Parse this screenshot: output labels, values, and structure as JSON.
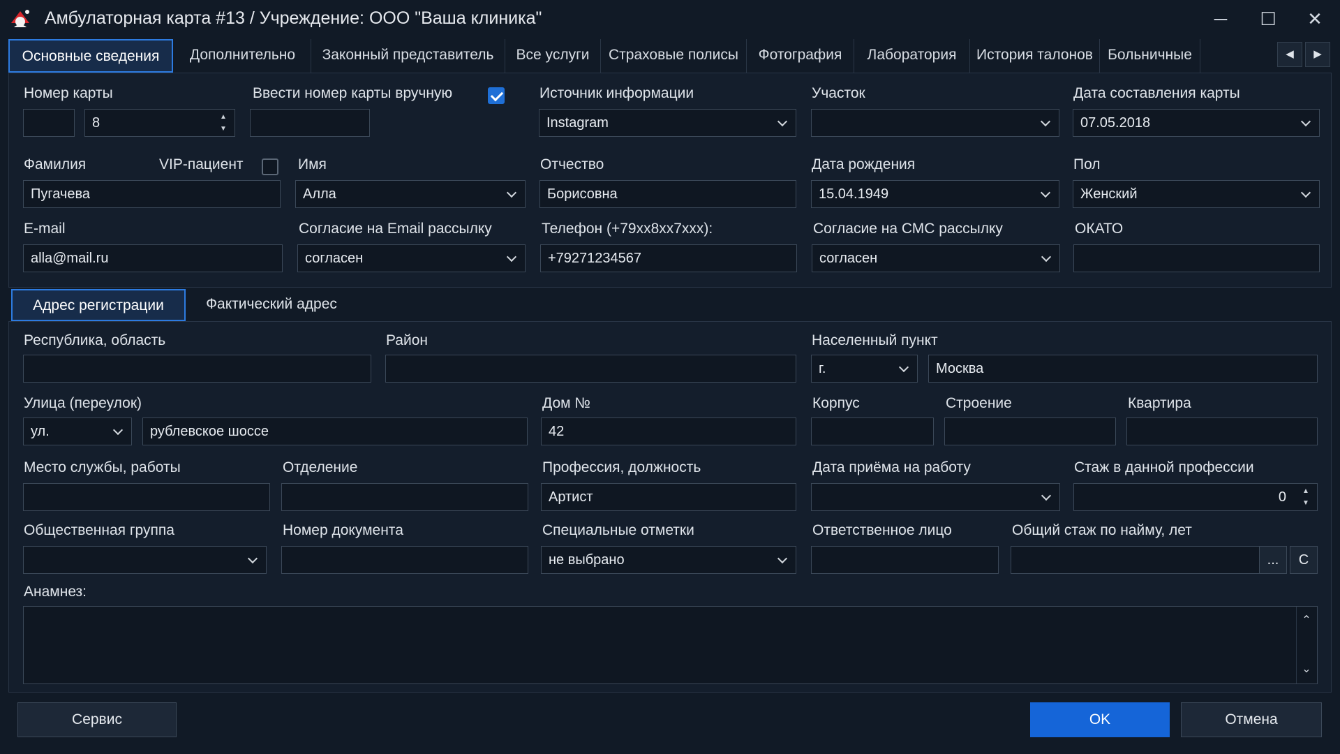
{
  "window": {
    "title": "Амбулаторная карта #13 / Учреждение: ООО \"Ваша клиника\"",
    "icon": "app-logo-icon",
    "minimize": "─",
    "maximize": "☐",
    "close": "✕"
  },
  "tabs": [
    {
      "label": "Основные сведения"
    },
    {
      "label": "Дополнительно"
    },
    {
      "label": "Законный представитель"
    },
    {
      "label": "Все услуги"
    },
    {
      "label": "Страховые полисы"
    },
    {
      "label": "Фотография"
    },
    {
      "label": "Лаборатория"
    },
    {
      "label": "История талонов"
    },
    {
      "label": "Больничные"
    }
  ],
  "tab_nav": {
    "prev": "◀",
    "next": "▶"
  },
  "main": {
    "card_number_label": "Номер карты",
    "card_number_prefix": "",
    "card_number_value": "8",
    "manual_label": "Ввести номер карты вручную",
    "manual_checked": true,
    "manual_value": "",
    "source_label": "Источник информации",
    "source_value": "Instagram",
    "district_label": "Участок",
    "district_value": "",
    "card_date_label": "Дата составления карты",
    "card_date_value": "07.05.2018",
    "surname_label": "Фамилия",
    "surname_value": "Пугачева",
    "vip_label": "VIP-пациент",
    "vip_checked": false,
    "name_label": "Имя",
    "name_value": "Алла",
    "patronymic_label": "Отчество",
    "patronymic_value": "Борисовна",
    "birth_label": "Дата рождения",
    "birth_value": "15.04.1949",
    "sex_label": "Пол",
    "sex_value": "Женский",
    "email_label": "E-mail",
    "email_value": "alla@mail.ru",
    "email_consent_label": "Согласие на Email рассылку",
    "email_consent_value": "согласен",
    "phone_label": "Телефон (+79xx8xx7xxx):",
    "phone_value": "+79271234567",
    "sms_consent_label": "Согласие на СМС рассылку",
    "sms_consent_value": "согласен",
    "okato_label": "ОКАТО",
    "okato_value": ""
  },
  "address_tabs": [
    {
      "label": "Адрес регистрации"
    },
    {
      "label": "Фактический адрес"
    }
  ],
  "address": {
    "region_label": "Республика, область",
    "region_value": "",
    "area_label": "Район",
    "area_value": "",
    "locality_label": "Населенный пункт",
    "locality_type": "г.",
    "locality_value": "Москва",
    "street_label": "Улица (переулок)",
    "street_type": "ул.",
    "street_value": "рублевское шоссе",
    "house_label": "Дом №",
    "house_value": "42",
    "building_label": "Корпус",
    "building_value": "",
    "structure_label": "Строение",
    "structure_value": "",
    "flat_label": "Квартира",
    "flat_value": "",
    "work_label": "Место службы, работы",
    "work_value": "",
    "dept_label": "Отделение",
    "dept_value": "",
    "profession_label": "Профессия, должность",
    "profession_value": "Артист",
    "hire_date_label": "Дата приёма на работу",
    "hire_date_value": "",
    "experience_label": "Стаж в данной профессии",
    "experience_value": "0",
    "group_label": "Общественная группа",
    "group_value": "",
    "doc_label": "Номер документа",
    "doc_value": "",
    "marks_label": "Специальные отметки",
    "marks_value": "не выбрано",
    "responsible_label": "Ответственное лицо",
    "responsible_value": "",
    "total_exp_label": "Общий стаж по найму, лет",
    "total_exp_value": "",
    "browse_btn": "...",
    "clear_btn": "C",
    "anamnesis_label": "Анамнез:",
    "anamnesis_value": ""
  },
  "footer": {
    "service": "Сервис",
    "ok": "OK",
    "cancel": "Отмена"
  }
}
